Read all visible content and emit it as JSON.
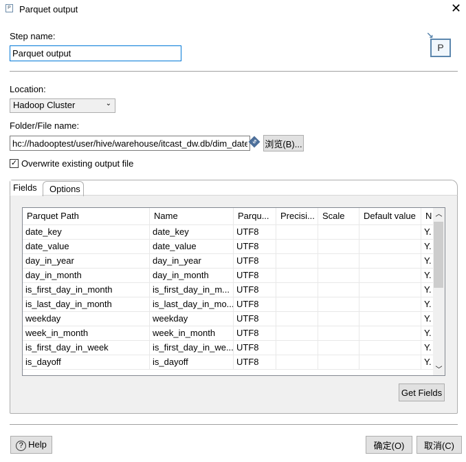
{
  "window": {
    "title": "Parquet output",
    "icon": "parquet-icon"
  },
  "step": {
    "label": "Step name:",
    "value": "Parquet output"
  },
  "location": {
    "label": "Location:",
    "value": "Hadoop Cluster"
  },
  "folder": {
    "label": "Folder/File name:",
    "value": "hc://hadooptest/user/hive/warehouse/itcast_dw.db/dim_date",
    "browse": "浏览(B)..."
  },
  "overwrite": {
    "label": "Overwrite existing output file",
    "checked": true
  },
  "tabs": [
    {
      "label": "Fields"
    },
    {
      "label": "Options"
    }
  ],
  "table": {
    "columns": [
      "Parquet Path",
      "Name",
      "Parqu...",
      "Precisi...",
      "Scale",
      "Default value",
      "N"
    ],
    "rows": [
      [
        "date_key",
        "date_key",
        "UTF8",
        "",
        "",
        "",
        "Y."
      ],
      [
        "date_value",
        "date_value",
        "UTF8",
        "",
        "",
        "",
        "Y."
      ],
      [
        "day_in_year",
        "day_in_year",
        "UTF8",
        "",
        "",
        "",
        "Y."
      ],
      [
        "day_in_month",
        "day_in_month",
        "UTF8",
        "",
        "",
        "",
        "Y."
      ],
      [
        "is_first_day_in_month",
        "is_first_day_in_m...",
        "UTF8",
        "",
        "",
        "",
        "Y."
      ],
      [
        "is_last_day_in_month",
        "is_last_day_in_mo...",
        "UTF8",
        "",
        "",
        "",
        "Y."
      ],
      [
        "weekday",
        "weekday",
        "UTF8",
        "",
        "",
        "",
        "Y."
      ],
      [
        "week_in_month",
        "week_in_month",
        "UTF8",
        "",
        "",
        "",
        "Y."
      ],
      [
        "is_first_day_in_week",
        "is_first_day_in_we...",
        "UTF8",
        "",
        "",
        "",
        "Y."
      ],
      [
        "is_dayoff",
        "is_dayoff",
        "UTF8",
        "",
        "",
        "",
        "Y."
      ]
    ]
  },
  "get_fields": "Get Fields",
  "footer": {
    "help": "Help",
    "ok": "确定(O)",
    "cancel": "取消(C)"
  }
}
